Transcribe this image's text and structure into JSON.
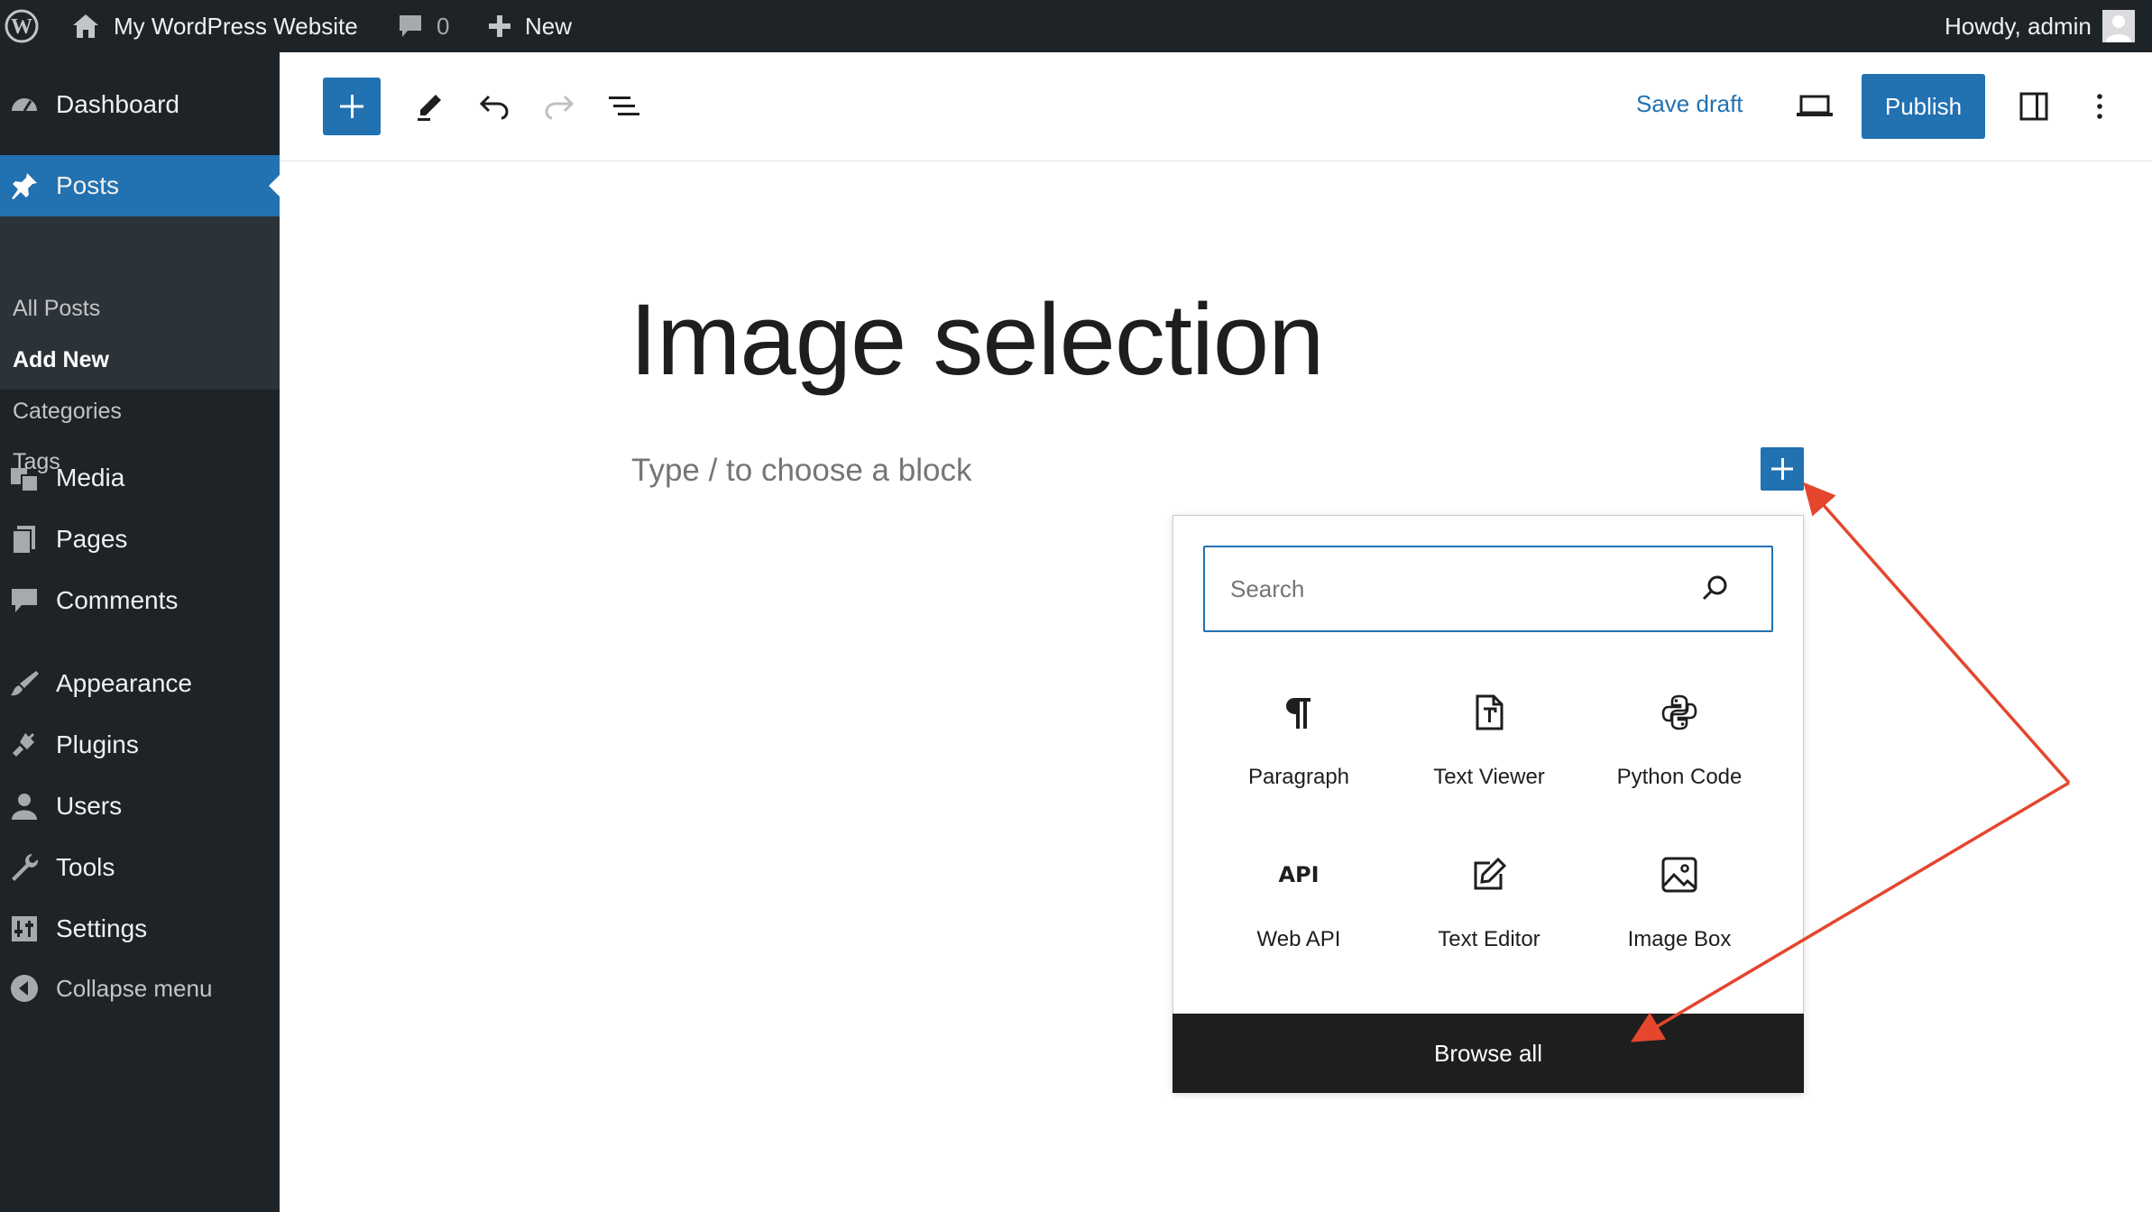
{
  "admin_bar": {
    "site_name": "My WordPress Website",
    "comments_count": "0",
    "new_label": "New",
    "greeting": "Howdy, admin"
  },
  "sidebar": {
    "items": [
      {
        "label": "Dashboard",
        "icon": "dashboard-icon"
      },
      {
        "label": "Posts",
        "icon": "pin-icon",
        "active": true
      },
      {
        "label": "Media",
        "icon": "media-icon"
      },
      {
        "label": "Pages",
        "icon": "pages-icon"
      },
      {
        "label": "Comments",
        "icon": "comments-icon"
      },
      {
        "label": "Appearance",
        "icon": "brush-icon"
      },
      {
        "label": "Plugins",
        "icon": "plugin-icon"
      },
      {
        "label": "Users",
        "icon": "users-icon"
      },
      {
        "label": "Tools",
        "icon": "wrench-icon"
      },
      {
        "label": "Settings",
        "icon": "settings-icon"
      },
      {
        "label": "Collapse menu",
        "icon": "collapse-icon"
      }
    ],
    "posts_submenu": [
      {
        "label": "All Posts"
      },
      {
        "label": "Add New",
        "current": true
      },
      {
        "label": "Categories"
      },
      {
        "label": "Tags"
      }
    ]
  },
  "toolbar": {
    "save_draft_label": "Save draft",
    "publish_label": "Publish"
  },
  "editor": {
    "post_title": "Image selection",
    "block_placeholder": "Type / to choose a block"
  },
  "inserter": {
    "search_placeholder": "Search",
    "blocks": [
      {
        "label": "Paragraph",
        "icon": "paragraph-icon"
      },
      {
        "label": "Text Viewer",
        "icon": "text-file-icon"
      },
      {
        "label": "Python Code",
        "icon": "python-icon"
      },
      {
        "label": "Web API",
        "icon": "api-icon"
      },
      {
        "label": "Text Editor",
        "icon": "edit-icon"
      },
      {
        "label": "Image Box",
        "icon": "image-icon"
      }
    ],
    "browse_all_label": "Browse all",
    "api_icon_text": "API"
  },
  "colors": {
    "admin_dark": "#1d2327",
    "submenu_bg": "#2c3338",
    "accent_blue": "#2271b1",
    "annotation_red": "#e4462e"
  }
}
